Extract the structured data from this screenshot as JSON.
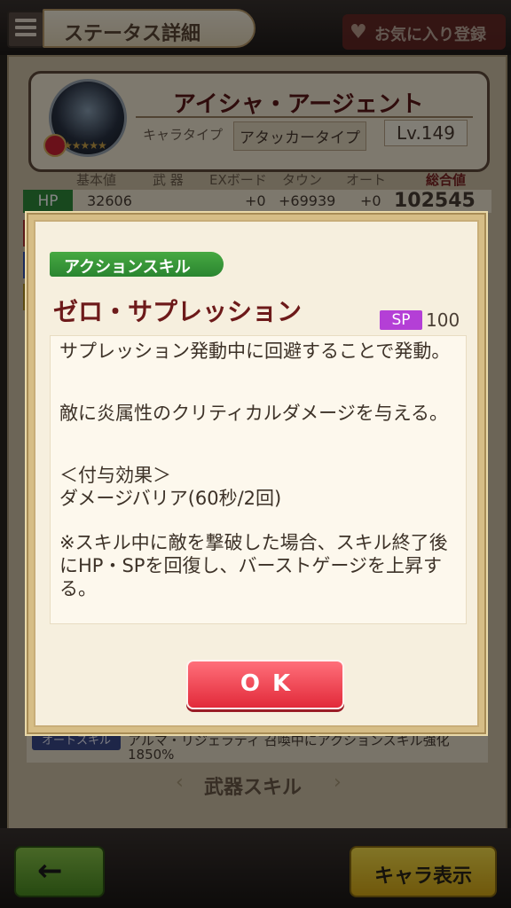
{
  "header": {
    "title": "ステータス詳細",
    "favorite_label": "お気に入り登録"
  },
  "character": {
    "name": "アイシャ・アージェント",
    "type_label": "キャラタイプ",
    "type_value": "アタッカータイプ",
    "level": "Lv.149",
    "stars": "★★★★★"
  },
  "stats": {
    "headers": [
      "基本値",
      "武 器",
      "EXボード",
      "タウン",
      "オート",
      "総合値"
    ],
    "hp": {
      "label": "HP",
      "base": "32606",
      "weapon": "",
      "exboard": "+0",
      "town": "+69939",
      "auto": "+0",
      "total": "102545"
    }
  },
  "auto_skill": {
    "label": "オートスキル",
    "description": "アルマ・リジェラティ 召喚中にアクションスキル強化",
    "value": "1850%"
  },
  "weapon_skill_nav": {
    "title": "武器スキル",
    "prev": "‹",
    "next": "›"
  },
  "footer": {
    "back_icon": "←",
    "chara_button_label": "キャラ表示"
  },
  "modal": {
    "tag": "アクションスキル",
    "skill_name": "ゼロ・サプレッション",
    "sp_label": "SP",
    "sp_value": "100",
    "description": [
      "サプレッション発動中に回避することで発動。",
      "敵に炎属性のクリティカルダメージを与える。",
      "＜付与効果＞\nダメージバリア(60秒/2回)",
      "※スキル中に敵を撃破した場合、スキル終了後にHP・SPを回復し、バーストゲージを上昇する。"
    ],
    "ok_label": "OK"
  },
  "colors": {
    "accent_green": "#2e8b3a",
    "ok_red": "#e22a3a",
    "sp_purple": "#b43fd6",
    "skill_name": "#6d1a1a"
  }
}
